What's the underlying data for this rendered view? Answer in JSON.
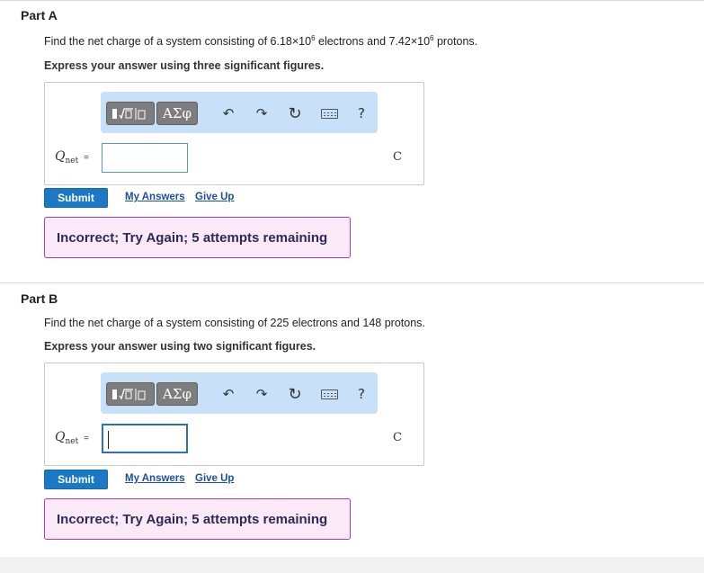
{
  "parts": [
    {
      "title": "Part A",
      "question_prefix": "Find the net charge of a system consisting of 6.18×10",
      "question_exp1": "6",
      "question_middle": " electrons and 7.42×10",
      "question_exp2": "6",
      "question_suffix": " protons.",
      "instruction": "Express your answer using three significant figures.",
      "variable_main": "Q",
      "variable_sub": "net",
      "equals": "=",
      "input_value": "",
      "unit": "C",
      "submit_label": "Submit",
      "my_answers_label": "My Answers",
      "give_up_label": "Give Up",
      "feedback": "Incorrect; Try Again; 5 attempts remaining"
    },
    {
      "title": "Part B",
      "question": "Find the net charge of a system consisting of 225 electrons and 148 protons.",
      "instruction": "Express your answer using two significant figures.",
      "variable_main": "Q",
      "variable_sub": "net",
      "equals": "=",
      "input_value": "",
      "unit": "C",
      "submit_label": "Submit",
      "my_answers_label": "My Answers",
      "give_up_label": "Give Up",
      "feedback": "Incorrect; Try Again; 5 attempts remaining"
    }
  ],
  "toolbar": {
    "greek_label": "ΑΣφ",
    "undo_icon": "↶",
    "redo_icon": "↷",
    "reset_icon": "↻",
    "help_label": "?",
    "icons": [
      "templates-icon",
      "greek-letters-icon",
      "undo-icon",
      "redo-icon",
      "reset-icon",
      "keyboard-icon",
      "help-icon"
    ]
  },
  "colors": {
    "toolbar_bg": "#c9e1f8",
    "submit_bg": "#1b78c7",
    "feedback_bg": "#fbe9f7",
    "feedback_border": "#b13ca4",
    "link": "#1c4f9c"
  }
}
